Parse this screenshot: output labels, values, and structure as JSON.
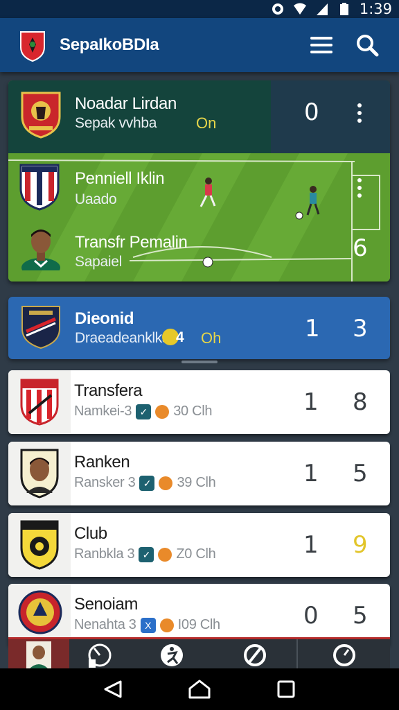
{
  "status": {
    "time": "1:39"
  },
  "app": {
    "title": "SepaIkoBDIa"
  },
  "featured": {
    "top_team": {
      "name": "Noadar Lirdan",
      "sub": "Sepak vvhba",
      "status": "On",
      "score": "0"
    },
    "match_team": {
      "name": "Penniell Iklin",
      "sub": "Uaado"
    },
    "bottom_team": {
      "name": "Transfr Pemalin",
      "sub": "Sapaiel",
      "score": "6"
    }
  },
  "blue_card": {
    "name": "Dieonid",
    "sub": "Draeadeanklks",
    "mark": "4",
    "status": "Oh",
    "score1": "1",
    "score2": "3"
  },
  "list": [
    {
      "name": "Transfera",
      "sub": "Namkei-3",
      "num": "30 Clh",
      "chip": "✓",
      "score1": "1",
      "score2": "8",
      "score2_color": "#3a3f44"
    },
    {
      "name": "Ranken",
      "sub": "Ransker 3",
      "num": "39 Clh",
      "chip": "✓",
      "score1": "1",
      "score2": "5",
      "score2_color": "#3a3f44"
    },
    {
      "name": "Club",
      "sub": "Ranbkla 3",
      "num": "Z0 Clh",
      "chip": "✓",
      "score1": "1",
      "score2": "9",
      "score2_color": "#e2c52a"
    },
    {
      "name": "Senoiam",
      "sub": "Nenahta 3",
      "num": "I09 Clh",
      "chip": "X",
      "score1": "0",
      "score2": "5",
      "score2_color": "#3a3f44"
    }
  ],
  "colors": {
    "appbar": "#12467e",
    "blue_card": "#2b68b2",
    "pitch": "#5a9c2e",
    "accent": "#e6d64a"
  }
}
